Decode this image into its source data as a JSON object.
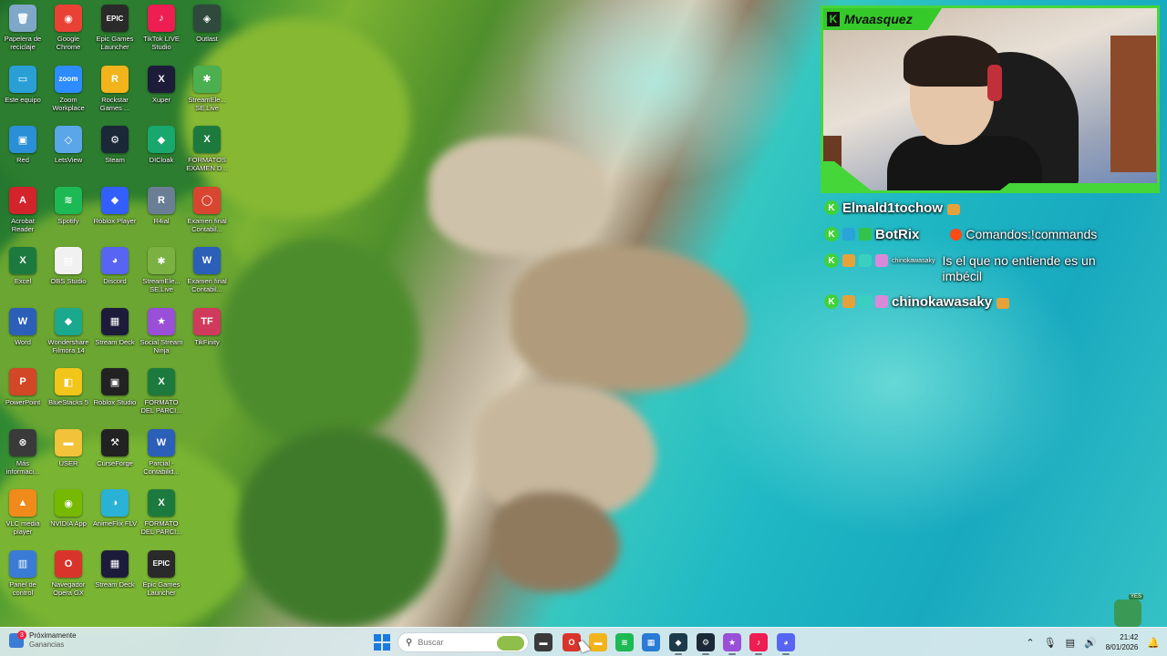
{
  "desktop": {
    "icons": [
      {
        "label": "Papelera de reciclaje",
        "glyph": "🗑",
        "color": "#7fa8c8"
      },
      {
        "label": "Google Chrome",
        "glyph": "◉",
        "color": "#e94235"
      },
      {
        "label": "Epic Games Launcher",
        "glyph": "EPIC",
        "color": "#2a2a2a"
      },
      {
        "label": "TikTok LIVE Studio",
        "glyph": "♪",
        "color": "#ee1d52"
      },
      {
        "label": "Outlast",
        "glyph": "◈",
        "color": "#2f4a3c"
      },
      {
        "label": "Este equipo",
        "glyph": "▭",
        "color": "#2a9fd6"
      },
      {
        "label": "Zoom Workplace",
        "glyph": "zoom",
        "color": "#2d8cff"
      },
      {
        "label": "Rockstar Games ...",
        "glyph": "R",
        "color": "#f2b31b"
      },
      {
        "label": "Xuper",
        "glyph": "X",
        "color": "#1d1d3a"
      },
      {
        "label": "StreamEle... SE.Live",
        "glyph": "✱",
        "color": "#4caf50"
      },
      {
        "label": "Red",
        "glyph": "▣",
        "color": "#2a8fd6"
      },
      {
        "label": "LetsView",
        "glyph": "◇",
        "color": "#5aa6e8"
      },
      {
        "label": "Steam",
        "glyph": "⚙",
        "color": "#1b2838"
      },
      {
        "label": "DICloak",
        "glyph": "◆",
        "color": "#18a86e"
      },
      {
        "label": "FORMATOS EXAMEN D...",
        "glyph": "X",
        "color": "#1d7a3e"
      },
      {
        "label": "Acrobat Reader",
        "glyph": "A",
        "color": "#d3242c"
      },
      {
        "label": "Spotify",
        "glyph": "≋",
        "color": "#1db954"
      },
      {
        "label": "Roblox Player",
        "glyph": "◆",
        "color": "#335fff"
      },
      {
        "label": "R4ial",
        "glyph": "R",
        "color": "#6a7f95"
      },
      {
        "label": "Examen final Contabil...",
        "glyph": "◯",
        "color": "#d84632"
      },
      {
        "label": "Excel",
        "glyph": "X",
        "color": "#1d7a3e"
      },
      {
        "label": "OBS Studio",
        "glyph": "▤",
        "color": "#f1f1f1"
      },
      {
        "label": "Discord",
        "glyph": "◕",
        "color": "#5865f2"
      },
      {
        "label": "StreamEle... SE.Live",
        "glyph": "✱",
        "color": "#7bb043"
      },
      {
        "label": "Examen final Contabil...",
        "glyph": "W",
        "color": "#2b5fb8"
      },
      {
        "label": "Word",
        "glyph": "W",
        "color": "#2b5fb8"
      },
      {
        "label": "Wondershare Filmora 14",
        "glyph": "◆",
        "color": "#1aa88f"
      },
      {
        "label": "Stream Deck",
        "glyph": "▦",
        "color": "#1c1c3a"
      },
      {
        "label": "Social Stream Ninja",
        "glyph": "★",
        "color": "#9a4fd8"
      },
      {
        "label": "TikFinity",
        "glyph": "TF",
        "color": "#d03a5c"
      },
      {
        "label": "PowerPoint",
        "glyph": "P",
        "color": "#d24726"
      },
      {
        "label": "BlueStacks 5",
        "glyph": "◧",
        "color": "#f2c51a"
      },
      {
        "label": "Roblox Studio",
        "glyph": "▣",
        "color": "#222"
      },
      {
        "label": "FORMATO DEL PARCI...",
        "glyph": "X",
        "color": "#1d7a3e"
      },
      {
        "label": "",
        "glyph": "",
        "color": "transparent"
      },
      {
        "label": "Más informaci...",
        "glyph": "⊗",
        "color": "#3a3a3a"
      },
      {
        "label": "USER",
        "glyph": "▬",
        "color": "#f2c23a"
      },
      {
        "label": "CurseForge",
        "glyph": "⚒",
        "color": "#222"
      },
      {
        "label": "Parcial - Contabilid...",
        "glyph": "W",
        "color": "#2b5fb8"
      },
      {
        "label": "",
        "glyph": "",
        "color": "transparent"
      },
      {
        "label": "VLC media player",
        "glyph": "▲",
        "color": "#f08a1a"
      },
      {
        "label": "NVIDIA App",
        "glyph": "◉",
        "color": "#76b900"
      },
      {
        "label": "AnimeFlix FLV",
        "glyph": "◑",
        "color": "#2ab2d6"
      },
      {
        "label": "FORMATO DEL PARCI...",
        "glyph": "X",
        "color": "#1d7a3e"
      },
      {
        "label": "",
        "glyph": "",
        "color": "transparent"
      },
      {
        "label": "Panel de control",
        "glyph": "▥",
        "color": "#3a7bd5"
      },
      {
        "label": "Navegador Opera GX",
        "glyph": "O",
        "color": "#d9342c"
      },
      {
        "label": "Stream Deck",
        "glyph": "▦",
        "color": "#1c1c3a"
      },
      {
        "label": "Epic Games Launcher",
        "glyph": "EPIC",
        "color": "#2a2a2a"
      },
      {
        "label": "",
        "glyph": "",
        "color": "transparent"
      }
    ]
  },
  "webcam": {
    "streamer_name": "Mvaasquez",
    "platform_glyph": "K",
    "accent_color": "#45d63a"
  },
  "chat": {
    "messages": [
      {
        "user": "Elmald1tochow",
        "text": "",
        "small": false
      },
      {
        "user": "BotRix",
        "text": "Comandos:!commands",
        "small": false
      },
      {
        "user": "chinokawasaky",
        "text": "Is el que no entiende es un imbécil",
        "small": true
      },
      {
        "user": "chinokawasaky",
        "text": "",
        "small": false
      }
    ]
  },
  "taskbar": {
    "widget_title": "Próximamente",
    "widget_subtitle": "Ganancias",
    "widget_badge": "3",
    "search_placeholder": "Buscar",
    "apps": [
      {
        "name": "file-explorer-dark",
        "glyph": "▬",
        "color": "#3a3a3a"
      },
      {
        "name": "opera",
        "glyph": "O",
        "color": "#d9342c"
      },
      {
        "name": "folder",
        "glyph": "▬",
        "color": "#f2b31b"
      },
      {
        "name": "spotify",
        "glyph": "≋",
        "color": "#1db954"
      },
      {
        "name": "store",
        "glyph": "▦",
        "color": "#2a7bd5"
      },
      {
        "name": "capcut",
        "glyph": "◆",
        "color": "#1c3a4a"
      },
      {
        "name": "steam",
        "glyph": "⚙",
        "color": "#1b2838"
      },
      {
        "name": "social-stream",
        "glyph": "★",
        "color": "#9a4fd8"
      },
      {
        "name": "tiktok",
        "glyph": "♪",
        "color": "#ee1d52"
      },
      {
        "name": "discord",
        "glyph": "◕",
        "color": "#5865f2"
      }
    ],
    "time": "21:42",
    "date": "8/01/2026"
  }
}
